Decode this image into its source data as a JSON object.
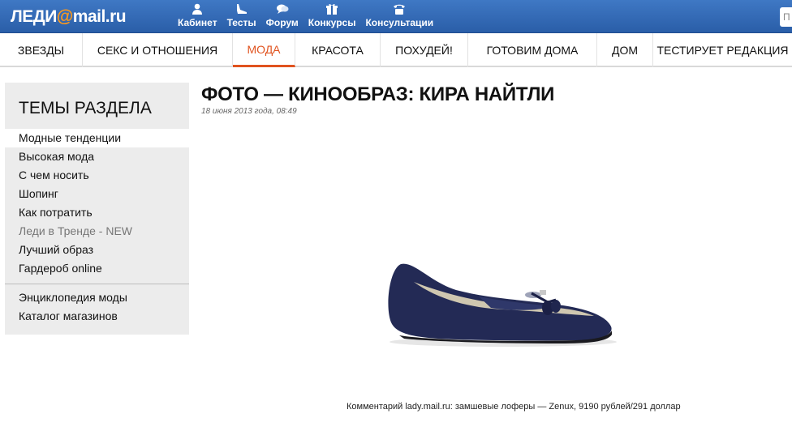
{
  "header": {
    "logo_prefix": "ЛЕДИ",
    "logo_at": "@",
    "logo_suffix": "mail.ru",
    "links": [
      {
        "label": "Кабинет",
        "icon": "user-icon"
      },
      {
        "label": "Тесты",
        "icon": "shoe-icon"
      },
      {
        "label": "Форум",
        "icon": "chat-icon"
      },
      {
        "label": "Конкурсы",
        "icon": "gift-icon"
      },
      {
        "label": "Консультации",
        "icon": "phone-icon"
      }
    ],
    "search_placeholder": "П"
  },
  "nav": {
    "items": [
      "ЗВЕЗДЫ",
      "СЕКС И ОТНОШЕНИЯ",
      "МОДА",
      "КРАСОТА",
      "ПОХУДЕЙ!",
      "ГОТОВИМ ДОМА",
      "ДОМ",
      "ТЕСТИРУЕТ РЕДАКЦИЯ"
    ],
    "active": "МОДА"
  },
  "sidebar": {
    "title": "ТЕМЫ РАЗДЕЛА",
    "items": [
      "Модные тенденции",
      "Высокая мода",
      "С чем носить",
      "Шопинг",
      "Как потратить",
      "Леди в Тренде - NEW",
      "Лучший образ",
      "Гардероб online"
    ],
    "extra_items": [
      "Энциклопедия моды",
      "Каталог магазинов"
    ]
  },
  "article": {
    "title": "ФОТО — КИНООБРАЗ: КИРА НАЙТЛИ",
    "date": "18 июня 2013 года, 08:49",
    "image": "navy-suede-loafer",
    "caption": "Комментарий lady.mail.ru: замшевые лоферы — Zenux, 9190 рублей/291 доллар"
  },
  "colors": {
    "header_blue": "#2f66b3",
    "accent_orange": "#e0531f",
    "shoe_navy": "#232a55"
  }
}
